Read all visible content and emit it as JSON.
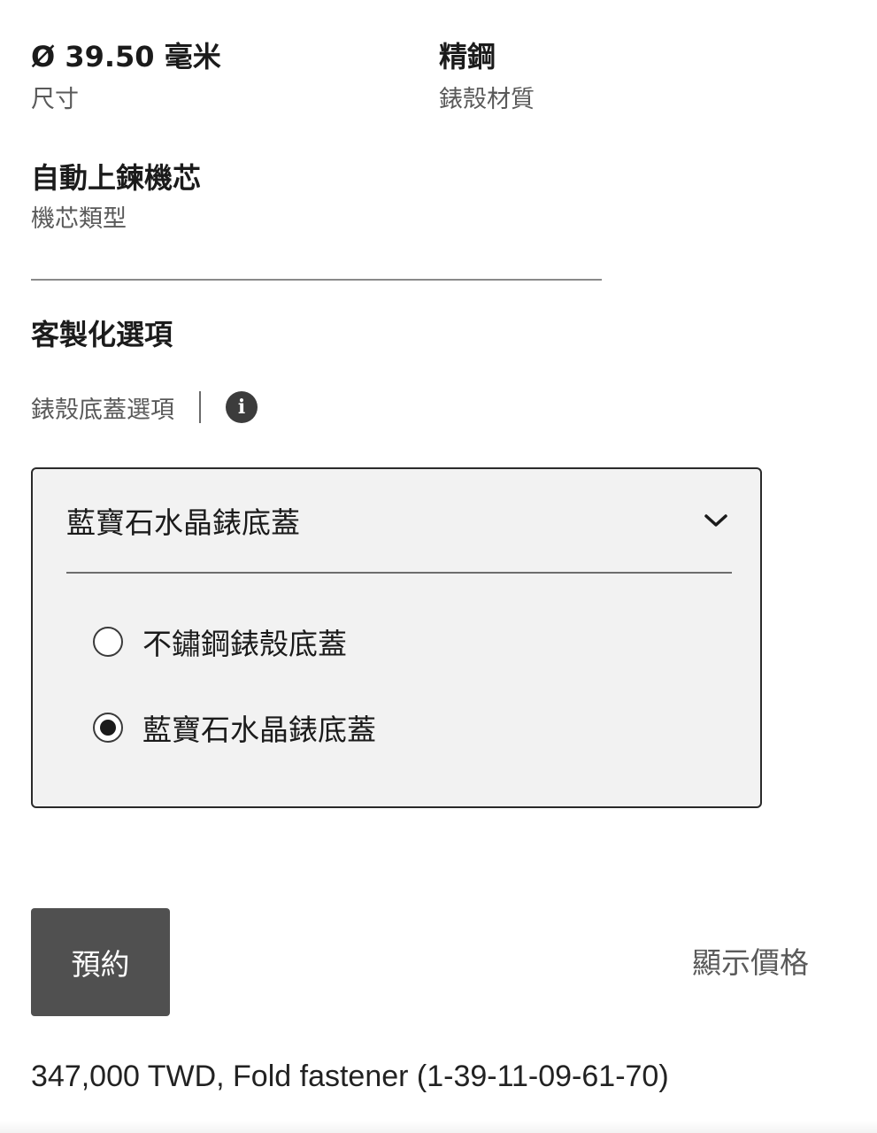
{
  "specs": {
    "size": {
      "value": "Ø 39.50 毫米",
      "label": "尺寸"
    },
    "case_material": {
      "value": "精鋼",
      "label": "錶殼材質"
    },
    "movement": {
      "value": "自動上鍊機芯",
      "label": "機芯類型"
    }
  },
  "customization": {
    "title": "客製化選項",
    "option_label": "錶殼底蓋選項",
    "info_icon": "info-icon",
    "selected_value": "藍寶石水晶錶底蓋",
    "options": [
      {
        "label": "不鏽鋼錶殼底蓋",
        "selected": false
      },
      {
        "label": "藍寶石水晶錶底蓋",
        "selected": true
      }
    ]
  },
  "actions": {
    "reserve_label": "預約",
    "show_price_label": "顯示價格"
  },
  "price_line": "347,000 TWD, Fold fastener (1-39-11-09-61-70)",
  "colors": {
    "button_bg": "#505050",
    "panel_bg": "#f2f2f2",
    "text_primary": "#1b1b1b",
    "text_secondary": "#5a5a5a"
  }
}
